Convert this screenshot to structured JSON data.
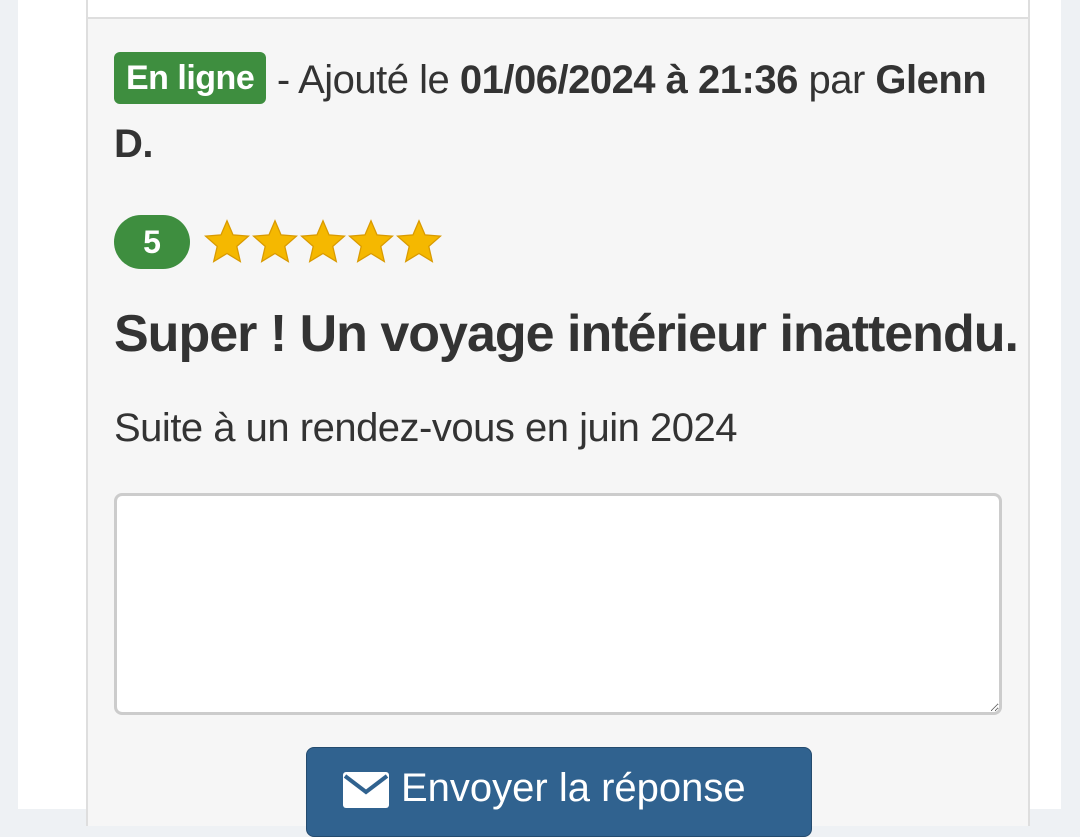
{
  "review": {
    "status_badge": "En ligne",
    "added_prefix": " - Ajouté le ",
    "datetime": "01/06/2024 à 21:36",
    "by_label": " par ",
    "author": "Glenn D.",
    "rating_value": "5",
    "rating_stars": 5,
    "star_color": "#f5b800",
    "title": "Super ! Un voyage intérieur inattendu.",
    "visit_context": "Suite à un rendez-vous en juin 2024"
  },
  "reply": {
    "value": "",
    "placeholder": "",
    "send_label": "Envoyer la réponse",
    "send_icon": "envelope-icon"
  },
  "colors": {
    "badge_green": "#3e8e3f",
    "button_blue": "#30628f"
  }
}
